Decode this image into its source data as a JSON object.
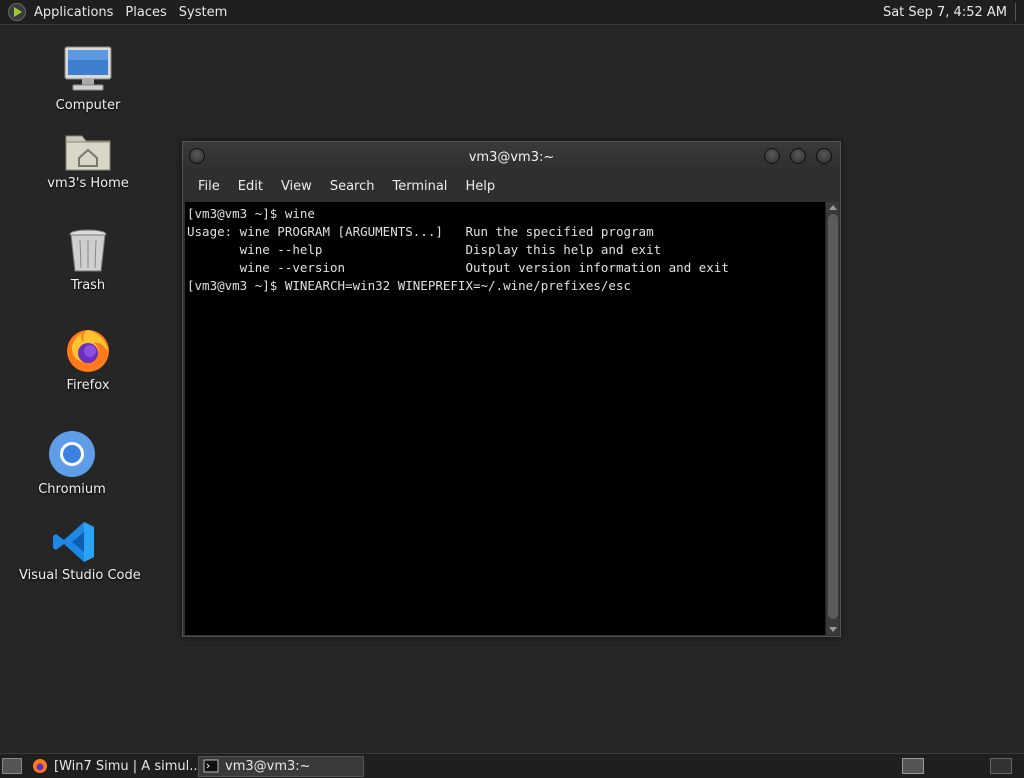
{
  "top_panel": {
    "menus": [
      "Applications",
      "Places",
      "System"
    ],
    "clock": "Sat Sep  7,  4:52 AM"
  },
  "desktop": {
    "icons": [
      {
        "label": "Computer",
        "icon": "computer-icon"
      },
      {
        "label": "vm3's Home",
        "icon": "home-folder-icon"
      },
      {
        "label": "Trash",
        "icon": "trash-icon"
      },
      {
        "label": "Firefox",
        "icon": "firefox-icon"
      },
      {
        "label": "Chromium",
        "icon": "chromium-icon"
      },
      {
        "label": "Visual Studio Code",
        "icon": "vscode-icon"
      }
    ]
  },
  "terminal": {
    "title": "vm3@vm3:~",
    "menu": [
      "File",
      "Edit",
      "View",
      "Search",
      "Terminal",
      "Help"
    ],
    "lines": [
      "[vm3@vm3 ~]$ wine",
      "Usage: wine PROGRAM [ARGUMENTS...]   Run the specified program",
      "       wine --help                   Display this help and exit",
      "       wine --version                Output version information and exit",
      "[vm3@vm3 ~]$ WINEARCH=win32 WINEPREFIX=~/.wine/prefixes/esc"
    ]
  },
  "taskbar": {
    "tasks": [
      {
        "label": "[Win7 Simu | A simul...",
        "icon": "firefox-icon"
      },
      {
        "label": "vm3@vm3:~",
        "icon": "terminal-icon"
      }
    ]
  },
  "colors": {
    "desktop_bg": "#262626",
    "panel_bg": "#1f1f1f",
    "terminal_bg": "#000000",
    "terminal_fg": "#e0e0e0"
  }
}
